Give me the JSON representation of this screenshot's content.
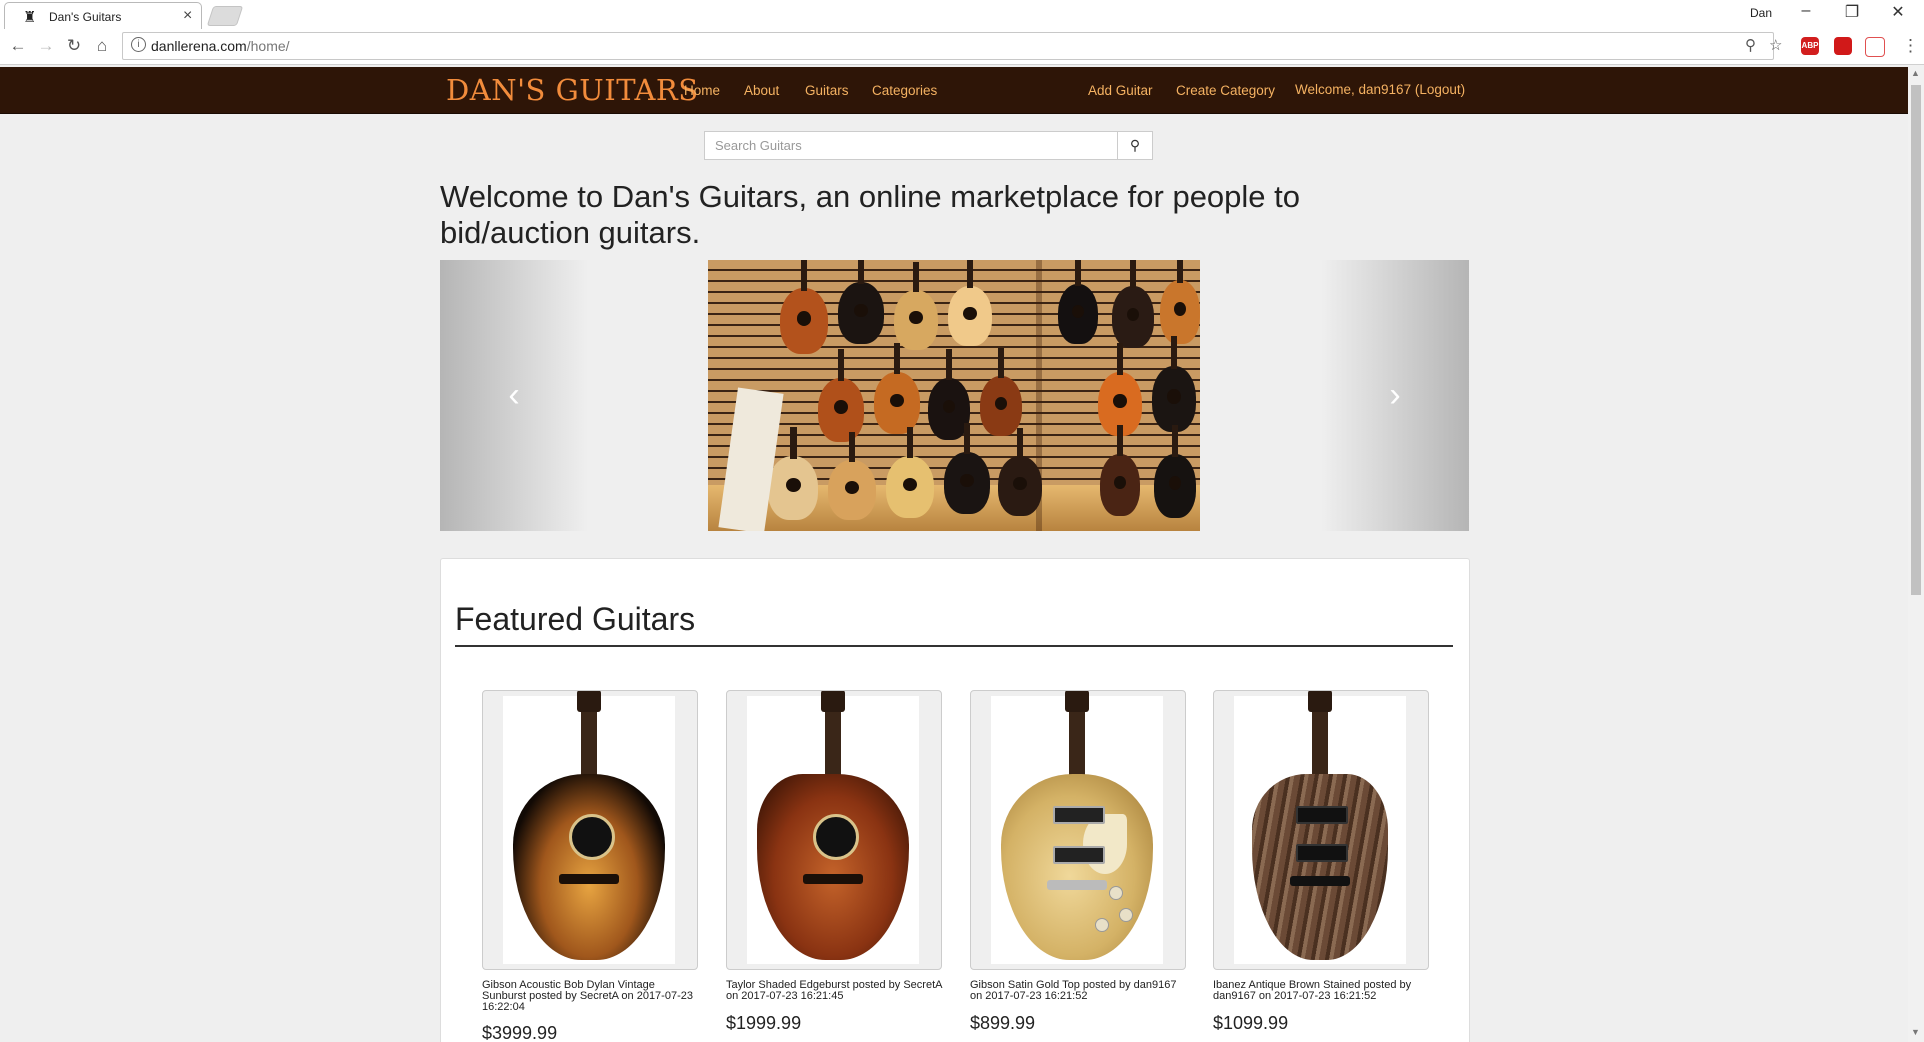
{
  "browser": {
    "tab_title": "Dan's Guitars",
    "tab_close": "×",
    "profile_name": "Dan",
    "url_host": "danllerena.com",
    "url_path": "/home/",
    "window_minimize": "–",
    "window_restore": "❐",
    "window_close": "✕",
    "extensions": [
      {
        "name": "adblock-plus-icon",
        "label": "ABP",
        "color": "#d21e1e"
      },
      {
        "name": "red-extension-icon",
        "label": "",
        "color": "#d11919"
      },
      {
        "name": "pdf-extension-icon",
        "label": "",
        "color": "#e05050"
      }
    ]
  },
  "navbar": {
    "brand": "DAN'S GUITARS",
    "links": {
      "home": "Home",
      "about": "About",
      "guitars": "Guitars",
      "categories": "Categories",
      "add_guitar": "Add Guitar",
      "create_category": "Create Category",
      "welcome": "Welcome, dan9167 (Logout)"
    },
    "colors": {
      "background": "#2e1507",
      "brand": "#f28c3c",
      "link": "#f5b262"
    }
  },
  "search": {
    "placeholder": "Search Guitars",
    "button_icon": "search-icon"
  },
  "hero": {
    "headline": "Welcome to Dan's Guitars, an online marketplace for people to bid/auction guitars.",
    "prev_icon": "‹",
    "next_icon": "›"
  },
  "featured": {
    "title": "Featured Guitars",
    "items": [
      {
        "caption": "Gibson Acoustic Bob Dylan Vintage Sunburst posted by SecretA on 2017-07-23 16:22:04",
        "price": "$3999.99"
      },
      {
        "caption": "Taylor Shaded Edgeburst posted by SecretA on 2017-07-23 16:21:45",
        "price": "$1999.99"
      },
      {
        "caption": "Gibson Satin Gold Top posted by dan9167 on 2017-07-23 16:21:52",
        "price": "$899.99"
      },
      {
        "caption": "Ibanez Antique Brown Stained posted by dan9167 on 2017-07-23 16:21:52",
        "price": "$1099.99"
      }
    ]
  }
}
